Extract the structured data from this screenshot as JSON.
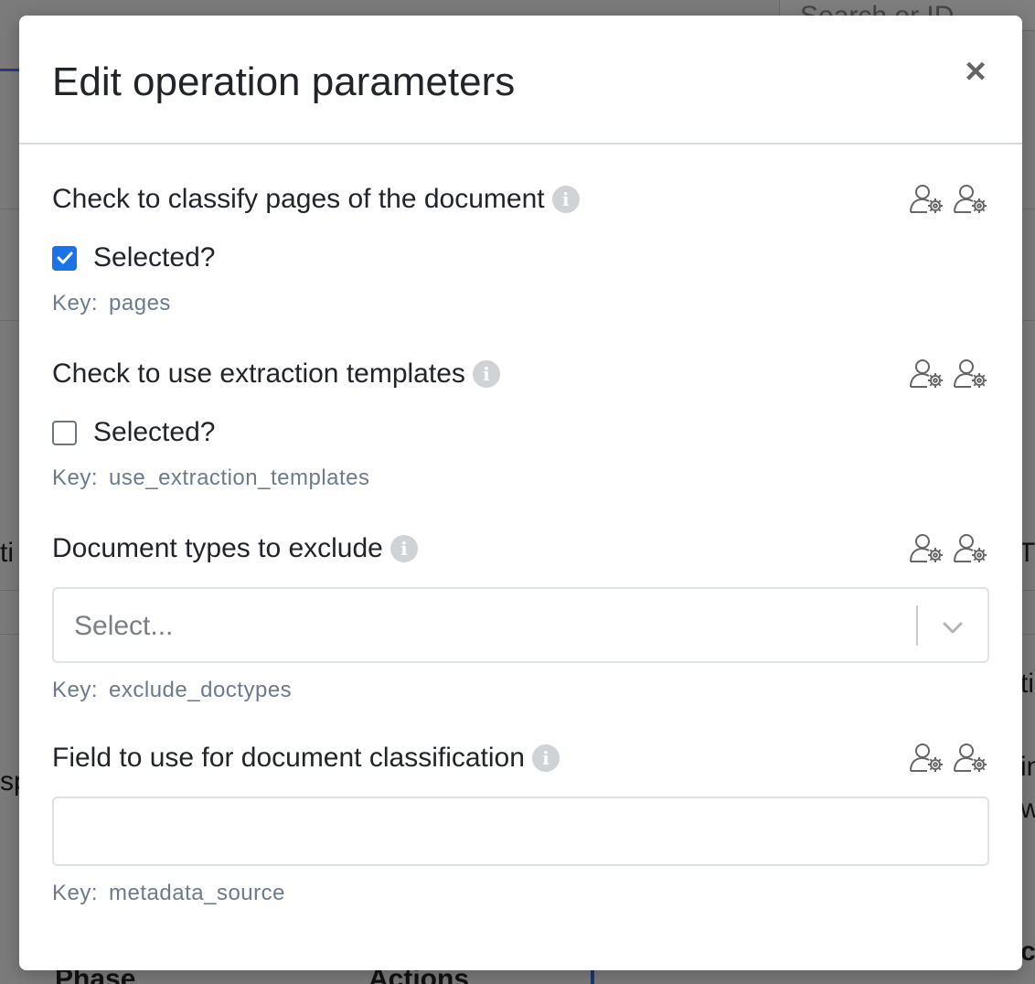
{
  "background": {
    "search_placeholder": "Search or ID",
    "fragments": [
      "ti",
      "sp",
      "Tr",
      "ti",
      "in",
      "w",
      "Phase",
      "Actions",
      "cr"
    ]
  },
  "modal": {
    "title": "Edit operation parameters",
    "close_label": "×"
  },
  "fields": [
    {
      "label": "Check to classify pages of the document",
      "checkbox_label": "Selected?",
      "checked": true,
      "key_label": "Key:",
      "key": "pages"
    },
    {
      "label": "Check to use extraction templates",
      "checkbox_label": "Selected?",
      "checked": false,
      "key_label": "Key:",
      "key": "use_extraction_templates"
    },
    {
      "label": "Document types to exclude",
      "placeholder": "Select...",
      "key_label": "Key:",
      "key": "exclude_doctypes"
    },
    {
      "label": "Field to use for document classification",
      "value": "",
      "key_label": "Key:",
      "key": "metadata_source"
    }
  ],
  "icons": {
    "info": "info-icon",
    "user_settings": "user-gear-icon",
    "close": "close-icon",
    "chevron": "chevron-down-icon"
  },
  "colors": {
    "accent": "#1a73e8",
    "overlay": "rgba(0,0,0,0.5)"
  }
}
